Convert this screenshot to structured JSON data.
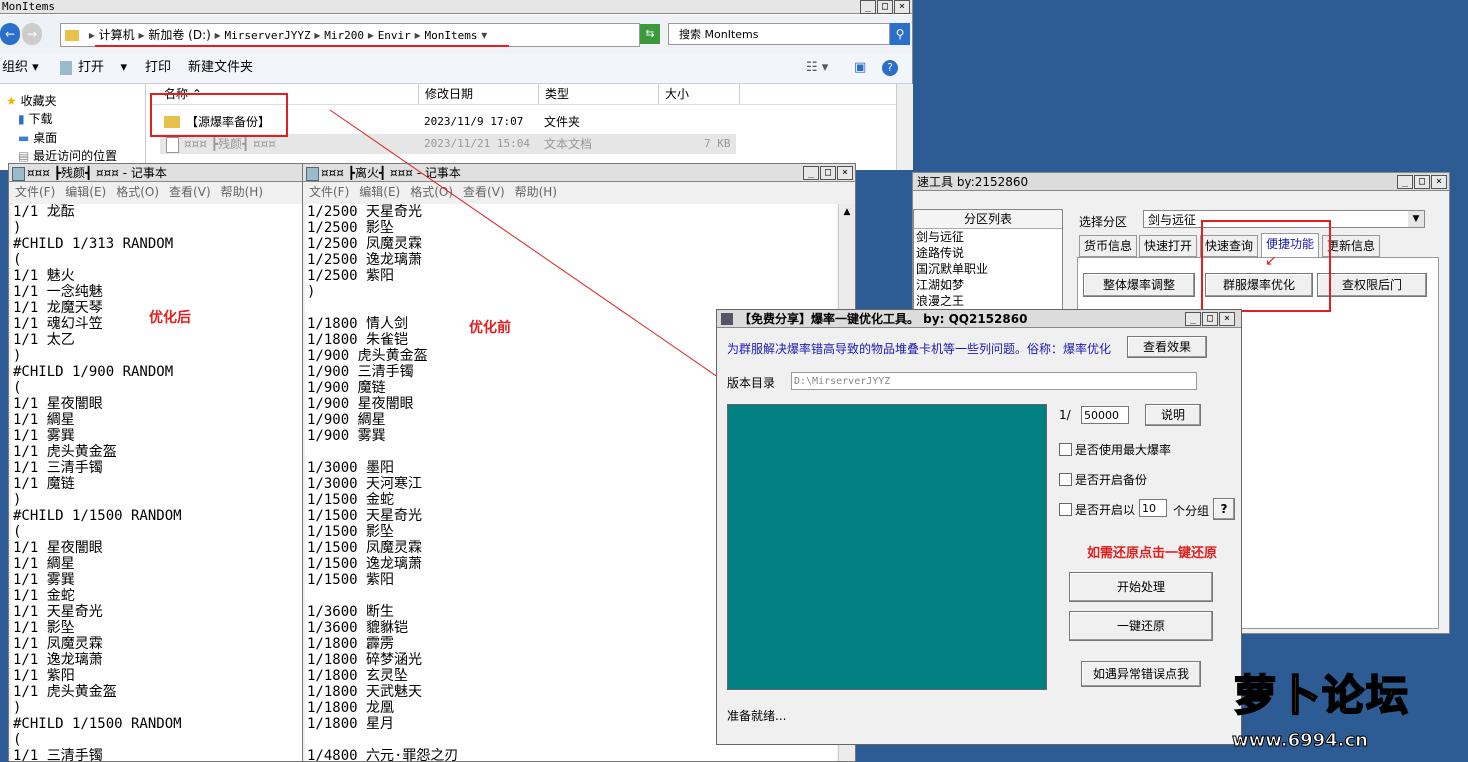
{
  "explorer": {
    "title": "MonItems",
    "breadcrumb": [
      "计算机",
      "新加卷 (D:)",
      "MirserverJYYZ",
      "Mir200",
      "Envir",
      "MonItems"
    ],
    "search_placeholder": "搜索 MonItems",
    "toolbar": {
      "organize": "组织",
      "open": "打开",
      "print": "打印",
      "new_folder": "新建文件夹"
    },
    "nav": {
      "favorites": "收藏夹",
      "downloads": "下载",
      "desktop": "桌面",
      "recent": "最近访问的位置"
    },
    "columns": {
      "name": "名称",
      "date": "修改日期",
      "type": "类型",
      "size": "大小"
    },
    "rows": [
      {
        "name": "【源爆率备份】",
        "date": "2023/11/9 17:07",
        "type": "文件夹",
        "size": ""
      },
      {
        "name": "¤¤¤ ┣残颜┫ ¤¤¤",
        "date": "2023/11/21 15:04",
        "type": "文本文档",
        "size": "7 KB"
      }
    ]
  },
  "notepad1": {
    "title": "¤¤¤ ┣残颜┫ ¤¤¤ - 记事本",
    "menu": [
      "文件(F)",
      "编辑(E)",
      "格式(O)",
      "查看(V)",
      "帮助(H)"
    ],
    "lines": [
      "1/1 龙酝",
      ")",
      "#CHILD 1/313 RANDOM",
      "(",
      "1/1 魅火",
      "1/1 一念纯魅",
      "1/1 龙魔天琴",
      "1/1 魂幻斗笠",
      "1/1 太乙",
      ")",
      "#CHILD 1/900 RANDOM",
      "(",
      "1/1 星夜闇眼",
      "1/1 綢星",
      "1/1 雾巽",
      "1/1 虎头黄金盔",
      "1/1 三清手镯",
      "1/1 魔链",
      ")",
      "#CHILD 1/1500 RANDOM",
      "(",
      "1/1 星夜闇眼",
      "1/1 綢星",
      "1/1 雾巽",
      "1/1 金蛇",
      "1/1 天星奇光",
      "1/1 影坠",
      "1/1 凤魔灵霖",
      "1/1 逸龙璃萧",
      "1/1 紫阳",
      "1/1 虎头黄金盔",
      ")",
      "#CHILD 1/1500 RANDOM",
      "(",
      "1/1 三清手镯"
    ],
    "annotation": "优化后"
  },
  "notepad2": {
    "title": "¤¤¤ ┣离火┫ ¤¤¤ - 记事本",
    "menu": [
      "文件(F)",
      "编辑(E)",
      "格式(O)",
      "查看(V)",
      "帮助(H)"
    ],
    "lines": [
      "1/2500 天星奇光",
      "1/2500 影坠",
      "1/2500 凤魔灵霖",
      "1/2500 逸龙璃萧",
      "1/2500 紫阳",
      ")",
      "",
      "1/1800 情人剑",
      "1/1800 朱雀铠",
      "1/900 虎头黄金盔",
      "1/900 三清手镯",
      "1/900 魔链",
      "1/900 星夜闇眼",
      "1/900 綢星",
      "1/900 雾巽",
      "",
      "1/3000 墨阳",
      "1/3000 天河寒江",
      "1/1500 金蛇",
      "1/1500 天星奇光",
      "1/1500 影坠",
      "1/1500 凤魔灵霖",
      "1/1500 逸龙璃萧",
      "1/1500 紫阳",
      "",
      "1/3600 断生",
      "1/3600 貔貅铠",
      "1/1800 霹雳",
      "1/1800 碎梦涵光",
      "1/1800 玄灵坠",
      "1/1800 天武魅天",
      "1/1800 龙凰",
      "1/1800 星月",
      "",
      "1/4800 六元·罪怨之刃"
    ],
    "annotation": "优化前"
  },
  "backtool": {
    "title": "速工具   by:2152860",
    "list_header": "分区列表",
    "list_items": [
      "剑与远征",
      "途路传说",
      "国沉默单职业",
      "江湖如梦",
      "浪漫之王"
    ],
    "select_label": "选择分区",
    "select_value": "剑与远征",
    "tabs": [
      "货币信息",
      "快速打开",
      "快速查询",
      "便捷功能",
      "更新信息"
    ],
    "buttons": {
      "adjust": "整体爆率调整",
      "optimize": "群服爆率优化",
      "query": "查权限后门"
    }
  },
  "tool": {
    "title": "【免费分享】爆率一键优化工具。   by: QQ2152860",
    "description": "为群服解决爆率错高导致的物品堆叠卡机等一些列问题。俗称：爆率优化",
    "view_effect": "查看效果",
    "version_label": "版本目录",
    "version_path": "D:\\MirserverJYYZ",
    "ratio_prefix": "1/",
    "ratio_value": "50000",
    "explain": "说明",
    "opt_max": "是否使用最大爆率",
    "opt_backup": "是否开启备份",
    "opt_group_prefix": "是否开启以",
    "opt_group_value": "10",
    "opt_group_suffix": "个分组",
    "help_btn": "?",
    "restore_hint": "如需还原点击一键还原",
    "start": "开始处理",
    "restore": "一键还原",
    "error": "如遇异常错误点我",
    "status": "准备就绪..."
  },
  "watermark": {
    "text": "萝卜论坛",
    "url": "www.6994.cn"
  },
  "colors": {
    "teal": "#008080",
    "red_annot": "#e02020",
    "blue_text": "#1a1ab0",
    "desktop": "#2d5b94"
  }
}
